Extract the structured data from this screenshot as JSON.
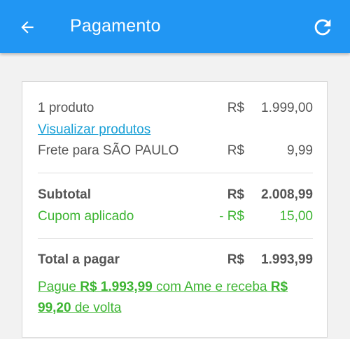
{
  "appbar": {
    "title": "Pagamento",
    "color": "#2196f3",
    "back_icon": "arrow-left-icon",
    "refresh_icon": "refresh-icon"
  },
  "summary": {
    "product": {
      "label": "1 produto",
      "currency": "R$",
      "value": "1.999,00"
    },
    "view_products_link": "Visualizar produtos",
    "shipping": {
      "label": "Frete para SÃO PAULO",
      "currency": "R$",
      "value": "9,99"
    },
    "subtotal": {
      "label": "Subtotal",
      "currency": "R$",
      "value": "2.008,99"
    },
    "coupon": {
      "label": "Cupom aplicado",
      "currency": "- R$",
      "value": "15,00",
      "color": "#3cb431"
    },
    "total": {
      "label": "Total a pagar",
      "currency": "R$",
      "value": "1.993,99"
    },
    "promo": {
      "part1": "Pague ",
      "amount1": "R$ 1.993,99",
      "part2": " com Ame e receba ",
      "amount2": "R$ 99,20",
      "part3": " de volta"
    }
  }
}
